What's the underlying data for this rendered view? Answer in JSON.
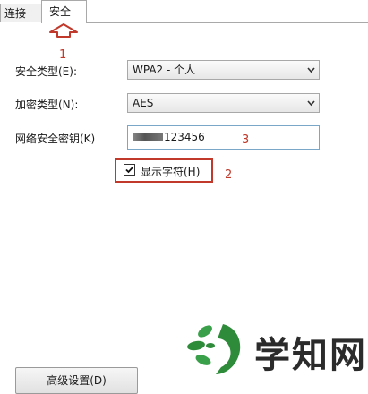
{
  "tabs": [
    {
      "label": "连接",
      "active": false
    },
    {
      "label": "安全",
      "active": true
    }
  ],
  "form": {
    "security_type_label": "安全类型(E):",
    "security_type_value": "WPA2 - 个人",
    "encryption_type_label": "加密类型(N):",
    "encryption_type_value": "AES",
    "network_key_label": "网络安全密钥(K)",
    "network_key_value": "123456",
    "show_chars_label": "显示字符(H)",
    "show_chars_checked": true,
    "advanced_button_label": "高级设置(D)"
  },
  "annotations": {
    "marker_1": "1",
    "marker_2": "2",
    "marker_3": "3",
    "color": "#c0392b"
  },
  "watermark": {
    "text": "学知网",
    "logo_color": "#2e8b3a"
  },
  "icons": {
    "tab_pointer": "up-arrow-outline-icon",
    "dropdown": "chevron-down-icon",
    "check": "check-icon"
  }
}
